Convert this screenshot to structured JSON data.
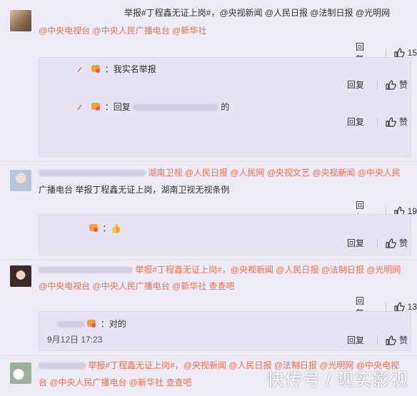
{
  "comments": [
    {
      "line1": "举报#丁程鑫无证上岗#，@央视新闻 @人民日报 @法制日报 @光明网",
      "line2": "@中央电视台 @中央人民广播电台 @新华社",
      "reply_label": "回复",
      "likes": "15"
    },
    {
      "line1": "湖南卫视 @人民日报 @人民网 @央视文艺 @央视新闻 @中央人民",
      "line2": "广播电台 举报丁程鑫无证上岗，湖南卫视无视条例",
      "reply_label": "回复",
      "likes": "19"
    },
    {
      "line1": "举报#丁程鑫无证上岗#，@央视新闻 @人民日报 @法制日报 @光明网",
      "line2": "@中央电视台 @中央人民广播电台 @新华社  查查吧",
      "reply_label": "回复",
      "likes": "13"
    },
    {
      "line1": "举报#丁程鑫无证上岗#，@央视新闻 @人民日报 @法制日报 @光明网 @中央电视",
      "line2": "台 @中央人民广播电台 @新华社  查查吧"
    }
  ],
  "subreplies": [
    {
      "text": "：我实名举报",
      "reply_label": "回复",
      "like_label": "赞"
    },
    {
      "text": "：回复",
      "suffix": "的",
      "reply_label": "回复",
      "like_label": "赞"
    },
    {
      "text": "：👍",
      "reply_label": "回复",
      "like_label": "赞"
    },
    {
      "text": "：对的",
      "date": "9月12日 17:23",
      "reply_label": "回复",
      "like_label": "赞"
    }
  ],
  "watermark": "快传号 / 现实影视"
}
